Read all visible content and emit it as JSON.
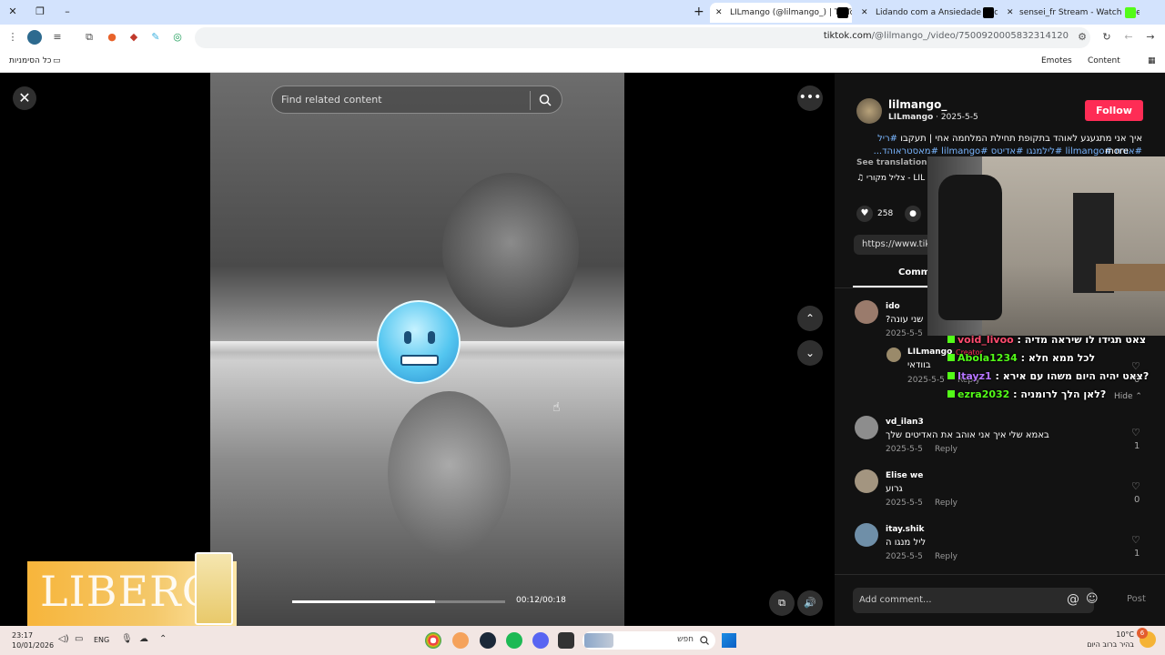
{
  "tabs": [
    {
      "title": "LILmango (@lilmango_) | TikTok",
      "favicon_color": "#000000",
      "active": true
    },
    {
      "title": "Lidando com a Ansiedade Soci",
      "favicon_color": "#000000",
      "active": false
    },
    {
      "title": "sensei_fr Stream - Watch Live on",
      "favicon_color": "#53fc18",
      "active": false
    }
  ],
  "address_bar": {
    "url_host": "tiktok.com",
    "url_path": "/@lilmango_/video/7500920005832314120"
  },
  "bookmarks": {
    "all_bookmarks": "כל הסימניות",
    "emotes": "Emotes",
    "content": "Content"
  },
  "video": {
    "search_placeholder": "Find related content",
    "current_time": "00:12/00:18",
    "progress": 0.67
  },
  "ad": {
    "brand": "LIBERO"
  },
  "creator": {
    "username": "lilmango_",
    "display_name": "LILmango",
    "date": "2025-5-5",
    "follow_label": "Follow",
    "description_text": "איך אני מתגעגע לאוהד בתקופת תחילת המלחמה אחי | תעקבו",
    "description_tags": "#ריל #אורח #lilmango #לילמנגו #אדיטס #lilmango #מאסטראוהד...",
    "more_label": "more",
    "see_translation": "See translation",
    "music": "צליל מקורי - LIL",
    "likes": "258",
    "link": "https://www.tiktok.com",
    "comments_tab": "Comme"
  },
  "comments": [
    {
      "name": "ido",
      "text": "שני עונה?",
      "date": "2025-5-5",
      "reply_label": "",
      "likes": "",
      "avatar": "#9a7b6c"
    },
    {
      "name": "vd_ilan3",
      "text": "באמא שלי איך אני אוהב את האדיטים שלך",
      "date": "2025-5-5",
      "reply_label": "Reply",
      "likes": "1",
      "avatar": "#8d8d8d"
    },
    {
      "name": "Elise we",
      "text": "גרוע",
      "date": "2025-5-5",
      "reply_label": "Reply",
      "likes": "0",
      "avatar": "#a39580"
    },
    {
      "name": "itay.shik",
      "text": "ליל מנגו ה",
      "date": "2025-5-5",
      "reply_label": "Reply",
      "likes": "1",
      "avatar": "#6f8fa8"
    }
  ],
  "reply": {
    "name": "LILmango",
    "badge": "Creator",
    "text": "בוודאי",
    "date": "2025-5-5",
    "reply_label": "Reply",
    "likes": "0"
  },
  "hide_label": "Hide",
  "add_comment_placeholder": "Add comment...",
  "post_label": "Post",
  "chat": [
    {
      "user": "void_livoo",
      "text": "צאט תגידו לו שיראה מדיה",
      "color": "#ff4b6e"
    },
    {
      "user": "Abola1234",
      "text": "לכל ממא חלא",
      "color": "#53fc18"
    },
    {
      "user": "Itayz1",
      "text": "צאט יהיה היום משהו עם אירא?",
      "color": "#b574ff"
    },
    {
      "user": "ezra2032",
      "text": "לאן הלך לרומניה?",
      "color": "#53fc18"
    }
  ],
  "taskbar": {
    "time": "23:17",
    "date": "10/01/2026",
    "lang": "ENG",
    "search_placeholder": "חפש",
    "temperature": "10°C",
    "weather": "בהיר ברוב היום",
    "notifications": "6"
  }
}
